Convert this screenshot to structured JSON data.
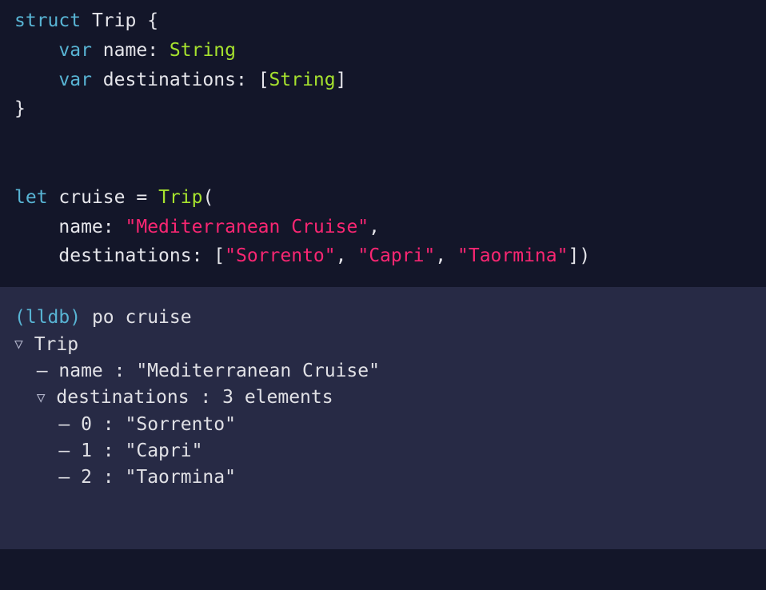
{
  "code": {
    "kw_struct": "struct",
    "type_Trip": "Trip",
    "kw_var1": "var",
    "field_name": "name",
    "type_String": "String",
    "kw_var2": "var",
    "field_dest": "destinations",
    "type_StringArrOpen": "[",
    "type_StringArrType": "String",
    "type_StringArrClose": "]",
    "kw_let": "let",
    "varCruise": "cruise",
    "ctorName": "Trip",
    "argNameLabel": "name",
    "argNameValue": "\"Mediterranean Cruise\"",
    "argDestLabel": "destinations",
    "arrOpen": "[",
    "dest0": "\"Sorrento\"",
    "dest1": "\"Capri\"",
    "dest2": "\"Taormina\"",
    "arrClose": "]"
  },
  "console": {
    "prompt": "(lldb)",
    "cmd": "po cruise",
    "root": "Trip",
    "nameKey": "name",
    "nameVal": "\"Mediterranean Cruise\"",
    "destKey": "destinations",
    "destSummary": "3 elements",
    "items": [
      {
        "idx": "0",
        "val": "\"Sorrento\""
      },
      {
        "idx": "1",
        "val": "\"Capri\""
      },
      {
        "idx": "2",
        "val": "\"Taormina\""
      }
    ]
  }
}
